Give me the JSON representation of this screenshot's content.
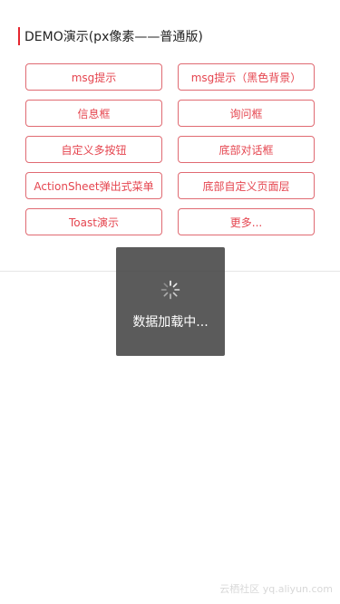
{
  "header": {
    "title": "DEMO演示(px像素——普通版)"
  },
  "buttons": [
    {
      "label": "msg提示"
    },
    {
      "label": "msg提示（黑色背景）"
    },
    {
      "label": "信息框"
    },
    {
      "label": "询问框"
    },
    {
      "label": "自定义多按钮"
    },
    {
      "label": "底部对话框"
    },
    {
      "label": "ActionSheet弹出式菜单"
    },
    {
      "label": "底部自定义页面层"
    },
    {
      "label": "Toast演示"
    },
    {
      "label": "更多..."
    }
  ],
  "loading": {
    "text": "数据加载中...",
    "icon": "spinner-icon"
  },
  "watermark": {
    "text": "云栖社区 yq.aliyun.com"
  },
  "colors": {
    "accent": "#e5262e",
    "button_text": "#e5454f",
    "button_border": "#e06a72",
    "overlay": "#404040"
  }
}
